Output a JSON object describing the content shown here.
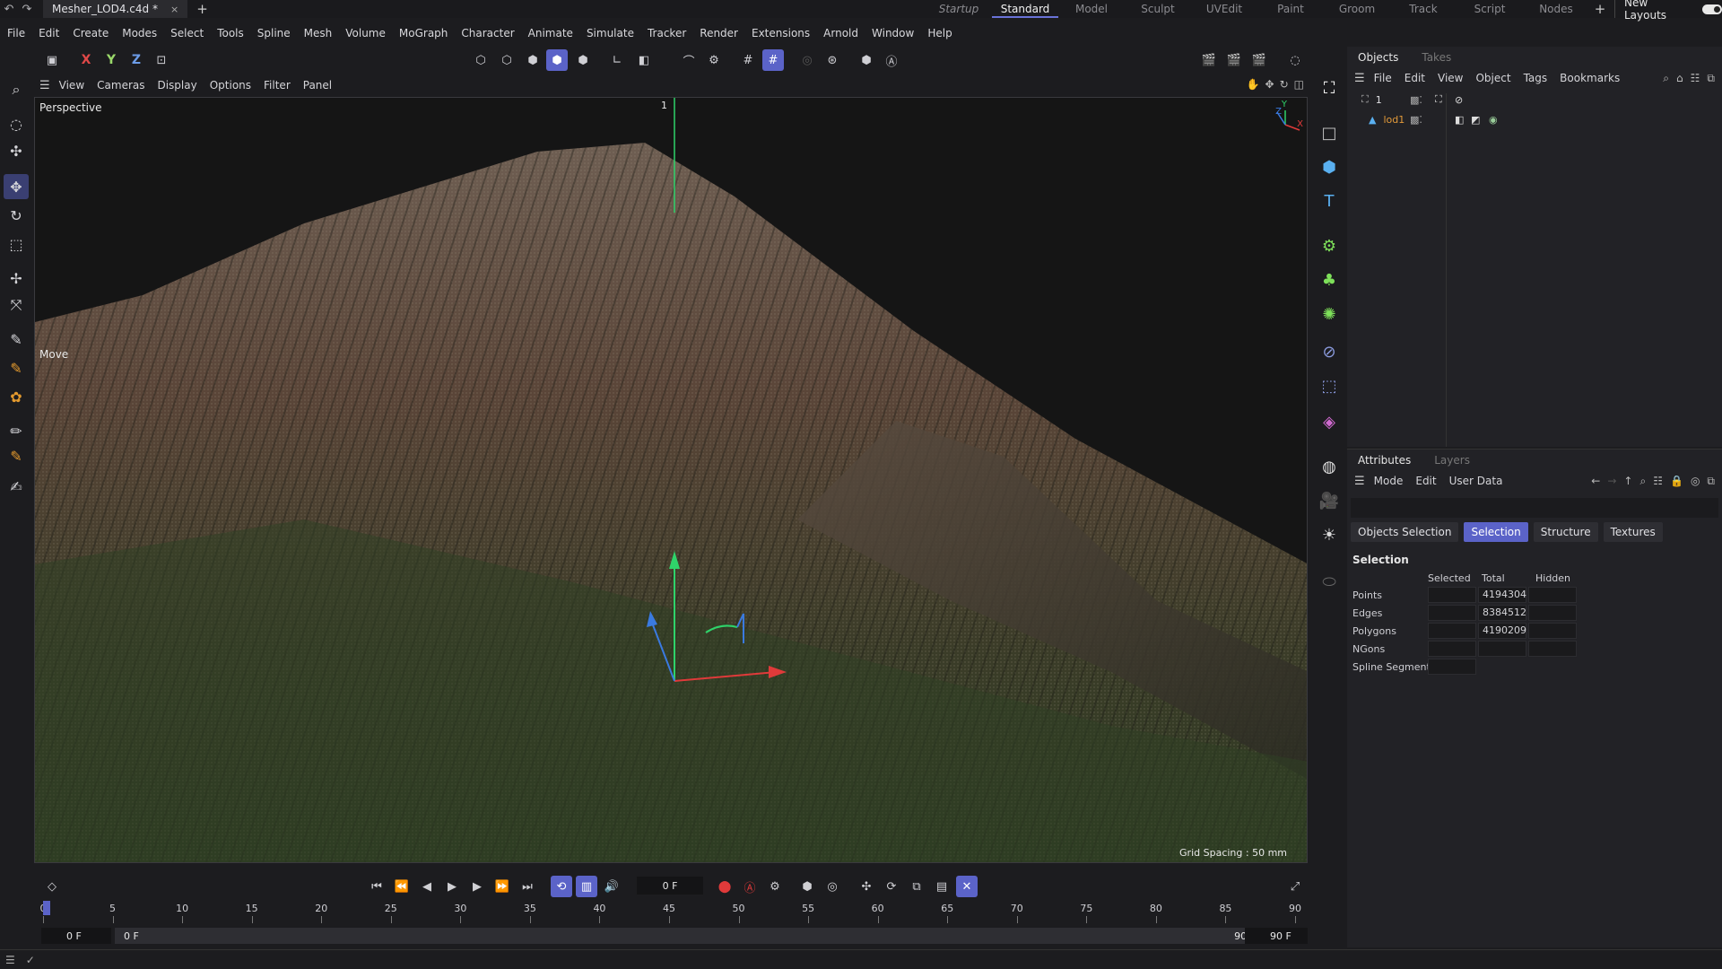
{
  "titlebar": {
    "file_name": "Mesher_LOD4.c4d *",
    "close": "×",
    "add": "+",
    "layouts": [
      "Startup",
      "Standard",
      "Model",
      "Sculpt",
      "UVEdit",
      "Paint",
      "Groom",
      "Track",
      "Script",
      "Nodes"
    ],
    "active_layout": "Standard",
    "add_layout": "+",
    "new_layouts": "New Layouts"
  },
  "menubar": [
    "File",
    "Edit",
    "Create",
    "Modes",
    "Select",
    "Tools",
    "Spline",
    "Mesh",
    "Volume",
    "MoGraph",
    "Character",
    "Animate",
    "Simulate",
    "Tracker",
    "Render",
    "Extensions",
    "Arnold",
    "Window",
    "Help"
  ],
  "toolbar": {
    "axis_x": "X",
    "axis_y": "Y",
    "axis_z": "Z"
  },
  "viewport": {
    "menu": [
      "View",
      "Cameras",
      "Display",
      "Options",
      "Filter",
      "Panel"
    ],
    "camera_label": "Perspective",
    "tool_label": "Move",
    "grid_spacing": "Grid Spacing : 50 mm",
    "null_label": "1",
    "axis_x": "X",
    "axis_y": "Y",
    "axis_z": "Z"
  },
  "timeline": {
    "current_frame": "0 F",
    "ruler_labels": [
      "0",
      "5",
      "10",
      "15",
      "20",
      "25",
      "30",
      "35",
      "40",
      "45",
      "50",
      "55",
      "60",
      "65",
      "70",
      "75",
      "80",
      "85",
      "90"
    ],
    "range_start": "0 F",
    "range_min": "0 F",
    "range_max": "90 F",
    "range_end": "90 F"
  },
  "objects_panel": {
    "tabs": [
      "Objects",
      "Takes"
    ],
    "active_tab": "Objects",
    "menu": [
      "File",
      "Edit",
      "View",
      "Object",
      "Tags",
      "Bookmarks"
    ],
    "items": [
      {
        "name": "1"
      },
      {
        "name": "lod1"
      }
    ]
  },
  "attributes_panel": {
    "tabs": [
      "Attributes",
      "Layers"
    ],
    "active_tab": "Attributes",
    "menu": [
      "Mode",
      "Edit",
      "User Data"
    ],
    "sub_tabs": [
      "Objects Selection",
      "Selection",
      "Structure",
      "Textures"
    ],
    "active_sub_tab": "Selection",
    "section_title": "Selection",
    "columns": [
      "Selected",
      "Total",
      "Hidden"
    ],
    "rows": [
      {
        "label": "Points",
        "selected": "",
        "total": "4194304",
        "hidden": ""
      },
      {
        "label": "Edges",
        "selected": "",
        "total": "8384512",
        "hidden": ""
      },
      {
        "label": "Polygons",
        "selected": "",
        "total": "4190209",
        "hidden": ""
      },
      {
        "label": "NGons",
        "selected": "",
        "total": "",
        "hidden": ""
      },
      {
        "label": "Spline Segments",
        "selected": "",
        "total": "",
        "hidden": ""
      }
    ]
  },
  "colors": {
    "accent": "#5b63c8",
    "background": "#1c1c1f",
    "panel": "#222226",
    "record": "#e03a3a"
  }
}
